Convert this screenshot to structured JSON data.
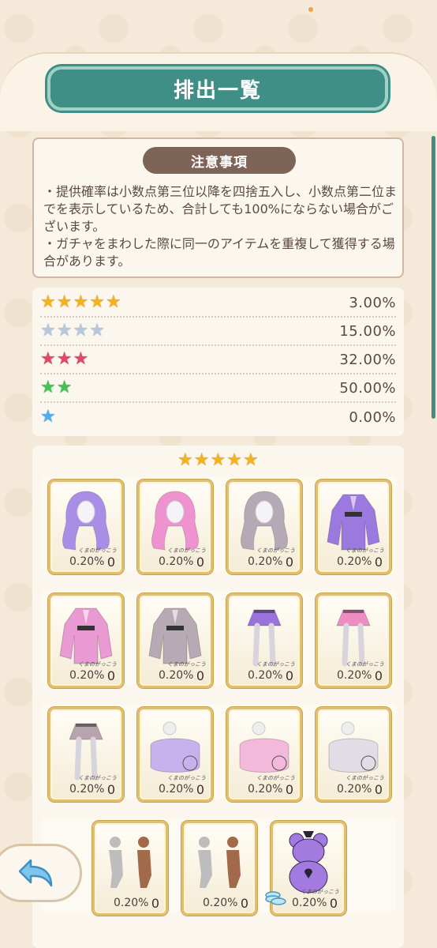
{
  "title": "排出一覧",
  "notes": {
    "heading": "注意事項",
    "line1": "・提供確率は小数点第三位以降を四捨五入し、小数点第二位までを表示しているため、合計しても100%にならない場合がございます。",
    "line2": "・ガチャをまわした際に同一のアイテムを重複して獲得する場合があります。"
  },
  "rarities": [
    {
      "stars": 5,
      "color": "gold",
      "percent": "3.00%"
    },
    {
      "stars": 4,
      "color": "silver",
      "percent": "15.00%"
    },
    {
      "stars": 3,
      "color": "red",
      "percent": "32.00%"
    },
    {
      "stars": 2,
      "color": "green",
      "percent": "50.00%"
    },
    {
      "stars": 1,
      "color": "blue",
      "percent": "0.00%"
    }
  ],
  "items_section": {
    "stars": 5,
    "items": [
      {
        "kind": "hair",
        "color": "#a98ee6",
        "rate": "0.20%",
        "count": "0"
      },
      {
        "kind": "hair",
        "color": "#ee93cf",
        "rate": "0.20%",
        "count": "0"
      },
      {
        "kind": "hair",
        "color": "#b4a9b4",
        "rate": "0.20%",
        "count": "0"
      },
      {
        "kind": "jacket",
        "color": "#9c79de",
        "rate": "0.20%",
        "count": "0"
      },
      {
        "kind": "jacket",
        "color": "#e99ad2",
        "rate": "0.20%",
        "count": "0"
      },
      {
        "kind": "jacket",
        "color": "#b8aab4",
        "rate": "0.20%",
        "count": "0"
      },
      {
        "kind": "skirt",
        "color": "#9b72dc",
        "rate": "0.20%",
        "count": "0"
      },
      {
        "kind": "skirt",
        "color": "#ee8cc4",
        "rate": "0.20%",
        "count": "0"
      },
      {
        "kind": "skirt",
        "color": "#b8a4ac",
        "rate": "0.20%",
        "count": "0"
      },
      {
        "kind": "cushion",
        "color": "#c7b2ee",
        "rate": "0.20%",
        "count": "0"
      },
      {
        "kind": "cushion",
        "color": "#f4b8da",
        "rate": "0.20%",
        "count": "0"
      },
      {
        "kind": "cushion",
        "color": "#e2dce6",
        "rate": "0.20%",
        "count": "0"
      },
      {
        "kind": "pose",
        "color": "#c9c0bc",
        "rate": "0.20%",
        "count": "0"
      },
      {
        "kind": "pose",
        "color": "#c9c0bc",
        "rate": "0.20%",
        "count": "0"
      },
      {
        "kind": "bear",
        "color": "#a37be0",
        "rate": "0.20%",
        "count": "0"
      }
    ],
    "brand_mark": "くまのがっこう"
  },
  "back_button": {
    "icon": "back-arrow-icon"
  },
  "accent_color": "#3f8f86"
}
